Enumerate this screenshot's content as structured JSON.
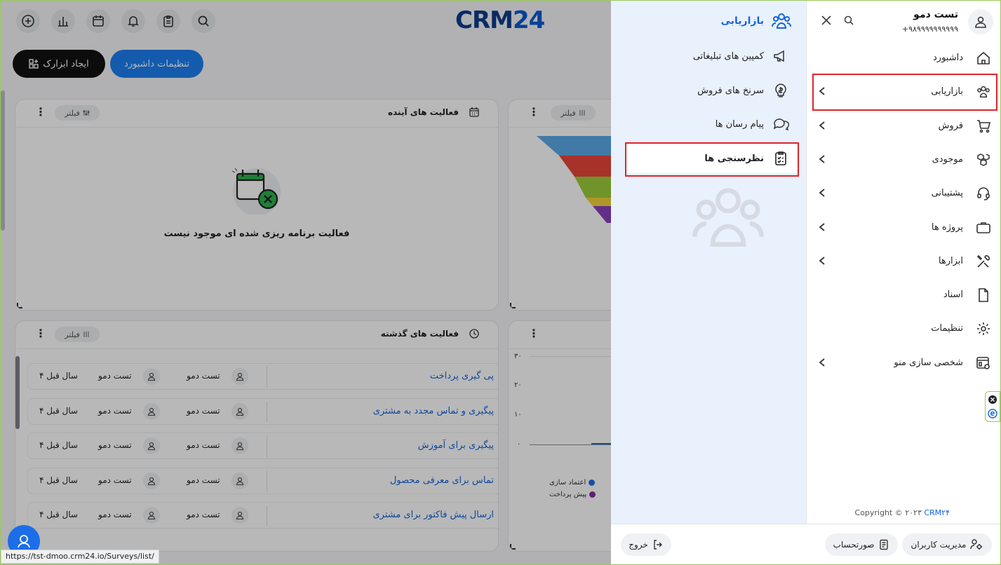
{
  "topbar": {
    "logo_prefix": "CRM",
    "logo_suffix": "24",
    "icons": [
      "add-circle-icon",
      "bar-chart-icon",
      "calendar-icon",
      "bell-icon",
      "clipboard-icon",
      "search-icon"
    ]
  },
  "toolbar": {
    "create_widget_label": "ایجاد ابزارک",
    "dashboard_settings_label": "تنظیمات داشبورد"
  },
  "upcoming_card": {
    "title": "فعالیت های آینده",
    "filter_label": "فیلتر",
    "empty_text": "فعالیت برنامه ریزی شده ای موجود نیست"
  },
  "funnel_card": {
    "filter_label": "فیلتر",
    "colors": [
      "#5aa9e6",
      "#e8463a",
      "#9ccd3a",
      "#f3d23a",
      "#8a3fbf"
    ]
  },
  "past_card": {
    "title": "فعالیت های گذشته",
    "filter_label": "فیلتر",
    "rows": [
      {
        "title": "پی گیری پرداخت",
        "user1": "تست دمو",
        "user2": "تست دمو",
        "time": "۴ سال قبل"
      },
      {
        "title": "پیگیری و تماس مجدد به مشتری",
        "user1": "تست دمو",
        "user2": "تست دمو",
        "time": "۴ سال قبل"
      },
      {
        "title": "پیگیری برای آموزش",
        "user1": "تست دمو",
        "user2": "تست دمو",
        "time": "۴ سال قبل"
      },
      {
        "title": "تماس برای معرفی محصول",
        "user1": "تست دمو",
        "user2": "تست دمو",
        "time": "۴ سال قبل"
      },
      {
        "title": "ارسال پیش فاکتور برای مشتری",
        "user1": "تست دمو",
        "user2": "تست دمو",
        "time": "۴ سال قبل"
      }
    ]
  },
  "chart_card": {
    "y_ticks": [
      "۳۰",
      "۲۰",
      "۱۰",
      "۰"
    ],
    "legend": [
      {
        "label": "اعتماد سازی",
        "color": "#1c6ee8"
      },
      {
        "label": "پیش پرداخت",
        "color": "#8a2a9a"
      }
    ]
  },
  "status_url": "https://tst-dmoo.crm24.io/Surveys/list/",
  "submenu": {
    "title": "بازاریابی",
    "items": [
      {
        "label": "کمپین های تبلیغاتی",
        "icon": "megaphone-icon"
      },
      {
        "label": "سرنخ های فروش",
        "icon": "lightbulb-dollar-icon"
      },
      {
        "label": "پیام رسان ها",
        "icon": "chat-bubbles-icon"
      },
      {
        "label": "نظرسنجی ها",
        "icon": "survey-clipboard-icon",
        "active": true
      }
    ]
  },
  "mainmenu": {
    "user_name": "تست دمو",
    "user_phone": "+۹۸۹۹۹۹۹۹۹۹۹۹",
    "items": [
      {
        "label": "داشبورد",
        "icon": "home-icon",
        "chevron": false
      },
      {
        "label": "بازاریابی",
        "icon": "users-group-icon",
        "chevron": true
      },
      {
        "label": "فروش",
        "icon": "cart-icon",
        "chevron": true
      },
      {
        "label": "موجودی",
        "icon": "boxes-icon",
        "chevron": true
      },
      {
        "label": "پشتیبانی",
        "icon": "headset-icon",
        "chevron": true
      },
      {
        "label": "پروژه ها",
        "icon": "briefcase-icon",
        "chevron": true
      },
      {
        "label": "ابزارها",
        "icon": "tools-icon",
        "chevron": true
      },
      {
        "label": "اسناد",
        "icon": "document-icon",
        "chevron": false
      },
      {
        "label": "تنظیمات",
        "icon": "gear-icon",
        "chevron": false
      },
      {
        "label": "شخصی سازی منو",
        "icon": "menu-customize-icon",
        "chevron": true
      }
    ],
    "copyright_text": "Copyright © ۲۰۲۳",
    "copyright_brand": "CRM۲۴"
  },
  "bottombar": {
    "user_management_label": "مدیریت کاربران",
    "invoice_label": "صورتحساب",
    "logout_label": "خروج"
  }
}
